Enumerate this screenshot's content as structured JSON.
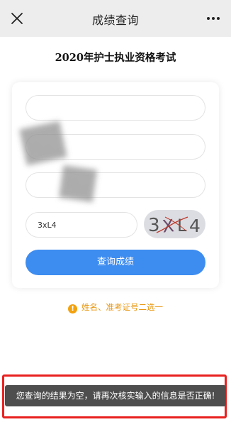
{
  "topbar": {
    "title": "成绩查询",
    "close_icon": "close-icon",
    "more_icon": "more-dots-icon"
  },
  "exam": {
    "title": "2020年护士执业资格考试"
  },
  "form": {
    "field_1_value": "",
    "field_2_value": "",
    "field_3_value": "",
    "captcha_input_value": "3xL4",
    "captcha_image_text": "3XL4",
    "submit_label": "查询成绩"
  },
  "hint": {
    "icon": "info-icon",
    "text": "姓名、准考证号二选一"
  },
  "toast": {
    "message": "您查询的结果为空，请再次核实输入的信息是否正确!"
  },
  "colors": {
    "primary": "#3d8cf0",
    "hint": "#e8960e",
    "highlight_border": "#e8201f",
    "toast_bg": "#4e4e4e"
  }
}
